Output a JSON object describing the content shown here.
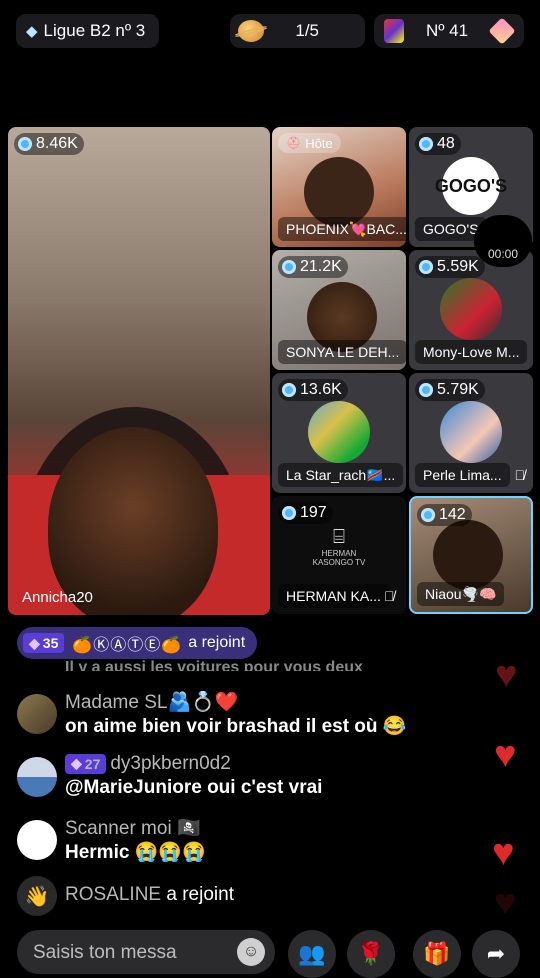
{
  "top": {
    "league": "Ligue B2 nº 3",
    "rounds": "1/5",
    "rank": "Nº 41"
  },
  "main_stream": {
    "viewers": "8.46K",
    "name": "Annicha20"
  },
  "tiles": [
    {
      "badge": "Hôte",
      "name": "PHOENIX💘BAC..."
    },
    {
      "viewers": "48",
      "name": "GOGO'S",
      "logo": "GOGO'S"
    },
    {
      "viewers": "21.2K",
      "name": "SONYA LE DEH..."
    },
    {
      "viewers": "5.59K",
      "name": "Mony-Love M..."
    },
    {
      "viewers": "13.6K",
      "name": "La Star_rach🇨🇩..."
    },
    {
      "viewers": "5.79K",
      "name": "Perle Lima..."
    },
    {
      "viewers": "197",
      "name": "HERMAN KA...",
      "logo": "HERMAN KASONGO TV"
    },
    {
      "viewers": "142",
      "name": "Niaou🌪️🧠"
    }
  ],
  "timer": "00:00",
  "chat": {
    "join_banner": {
      "level": "35",
      "user": "🍊ⓀⒶⓉⒺ🍊",
      "action": "a rejoint"
    },
    "faded": "Il y a aussi les voitures pour vous deux",
    "messages": [
      {
        "user": "Madame SL🫂💍❤️",
        "text": "on aime bien voir brashad il est où 😂"
      },
      {
        "level": "27",
        "user": "dy3pkbern0d2",
        "text": "@MarieJuniore oui c'est vrai"
      },
      {
        "user": "Scanner moi 🏴‍☠️",
        "text": "Hermic 😭😭😭"
      }
    ],
    "join_line": {
      "user": "ROSALINE",
      "action": "a rejoint"
    }
  },
  "input": {
    "placeholder": "Saisis ton messa"
  }
}
